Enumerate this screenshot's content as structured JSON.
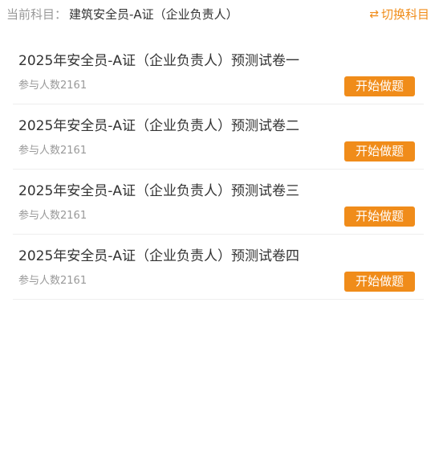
{
  "subject": {
    "label": "当前科目：",
    "value": "建筑安全员-A证（企业负责人）",
    "switch_icon": "⇄",
    "switch_label": "切换科目"
  },
  "exams": [
    {
      "title": "2025年安全员-A证（企业负责人）预测试卷一",
      "participants": "参与人数2161",
      "button": "开始做题"
    },
    {
      "title": "2025年安全员-A证（企业负责人）预测试卷二",
      "participants": "参与人数2161",
      "button": "开始做题"
    },
    {
      "title": "2025年安全员-A证（企业负责人）预测试卷三",
      "participants": "参与人数2161",
      "button": "开始做题"
    },
    {
      "title": "2025年安全员-A证（企业负责人）预测试卷四",
      "participants": "参与人数2161",
      "button": "开始做题"
    }
  ],
  "colors": {
    "accent": "#f08c1a",
    "text": "#333333",
    "muted": "#999999",
    "divider": "#eeeeee"
  }
}
